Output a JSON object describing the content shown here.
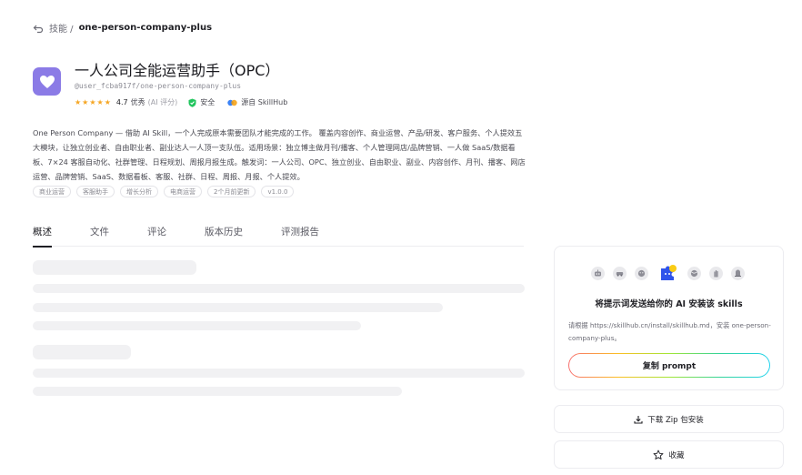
{
  "breadcrumb": {
    "parent": "技能 /",
    "current": "one-person-company-plus"
  },
  "app": {
    "title": "一人公司全能运营助手（OPC）",
    "handle": "@user_fcba917f/one-person-company-plus",
    "icon": "heart-icon",
    "accent_color": "#8b7be6"
  },
  "meta": {
    "stars": "★★★★★",
    "rating": "4.7",
    "rating_label": "优秀",
    "ai_note": "(AI 评分)",
    "safety_label": "安全",
    "source_label": "源自 SkillHub"
  },
  "description": "One Person Company — 借助 AI Skill，一个人完成原本需要团队才能完成的工作。 覆盖内容创作、商业运营、产品/研发、客户服务、个人提效五大模块，让独立创业者、自由职业者、副业达人一人顶一支队伍。适用场景：独立博主做月刊/播客、个人管理网店/品牌营销、一人做 SaaS/数据看板、7×24 客服自动化、社群管理、日程规划、周报月报生成。触发词：一人公司、OPC、独立创业、自由职业、副业、内容创作、月刊、播客、网店运营、品牌营销、SaaS、数据看板、客服、社群、日程、周报、月报、个人提效。",
  "tags": [
    "商业运营",
    "客服助手",
    "增长分析",
    "电商运营",
    "2个月前更新",
    "v1.0.0"
  ],
  "tabs": [
    {
      "label": "概述",
      "active": true
    },
    {
      "label": "文件",
      "active": false
    },
    {
      "label": "评论",
      "active": false
    },
    {
      "label": "版本历史",
      "active": false
    },
    {
      "label": "评测报告",
      "active": false
    }
  ],
  "install_card": {
    "title": "将提示词发送给你的 AI 安装该 skills",
    "text": "请根据 https://skillhub.cn/install/skillhub.md，安装 one-person-company-plus。",
    "copy_label": "复制 prompt",
    "agent_icons": [
      "robot-icon",
      "car-icon",
      "face-icon",
      "puzzle-icon",
      "ball-icon",
      "hand-icon",
      "hat-icon"
    ]
  },
  "download_label": "下载 Zip 包安装",
  "favorite_label": "收藏"
}
